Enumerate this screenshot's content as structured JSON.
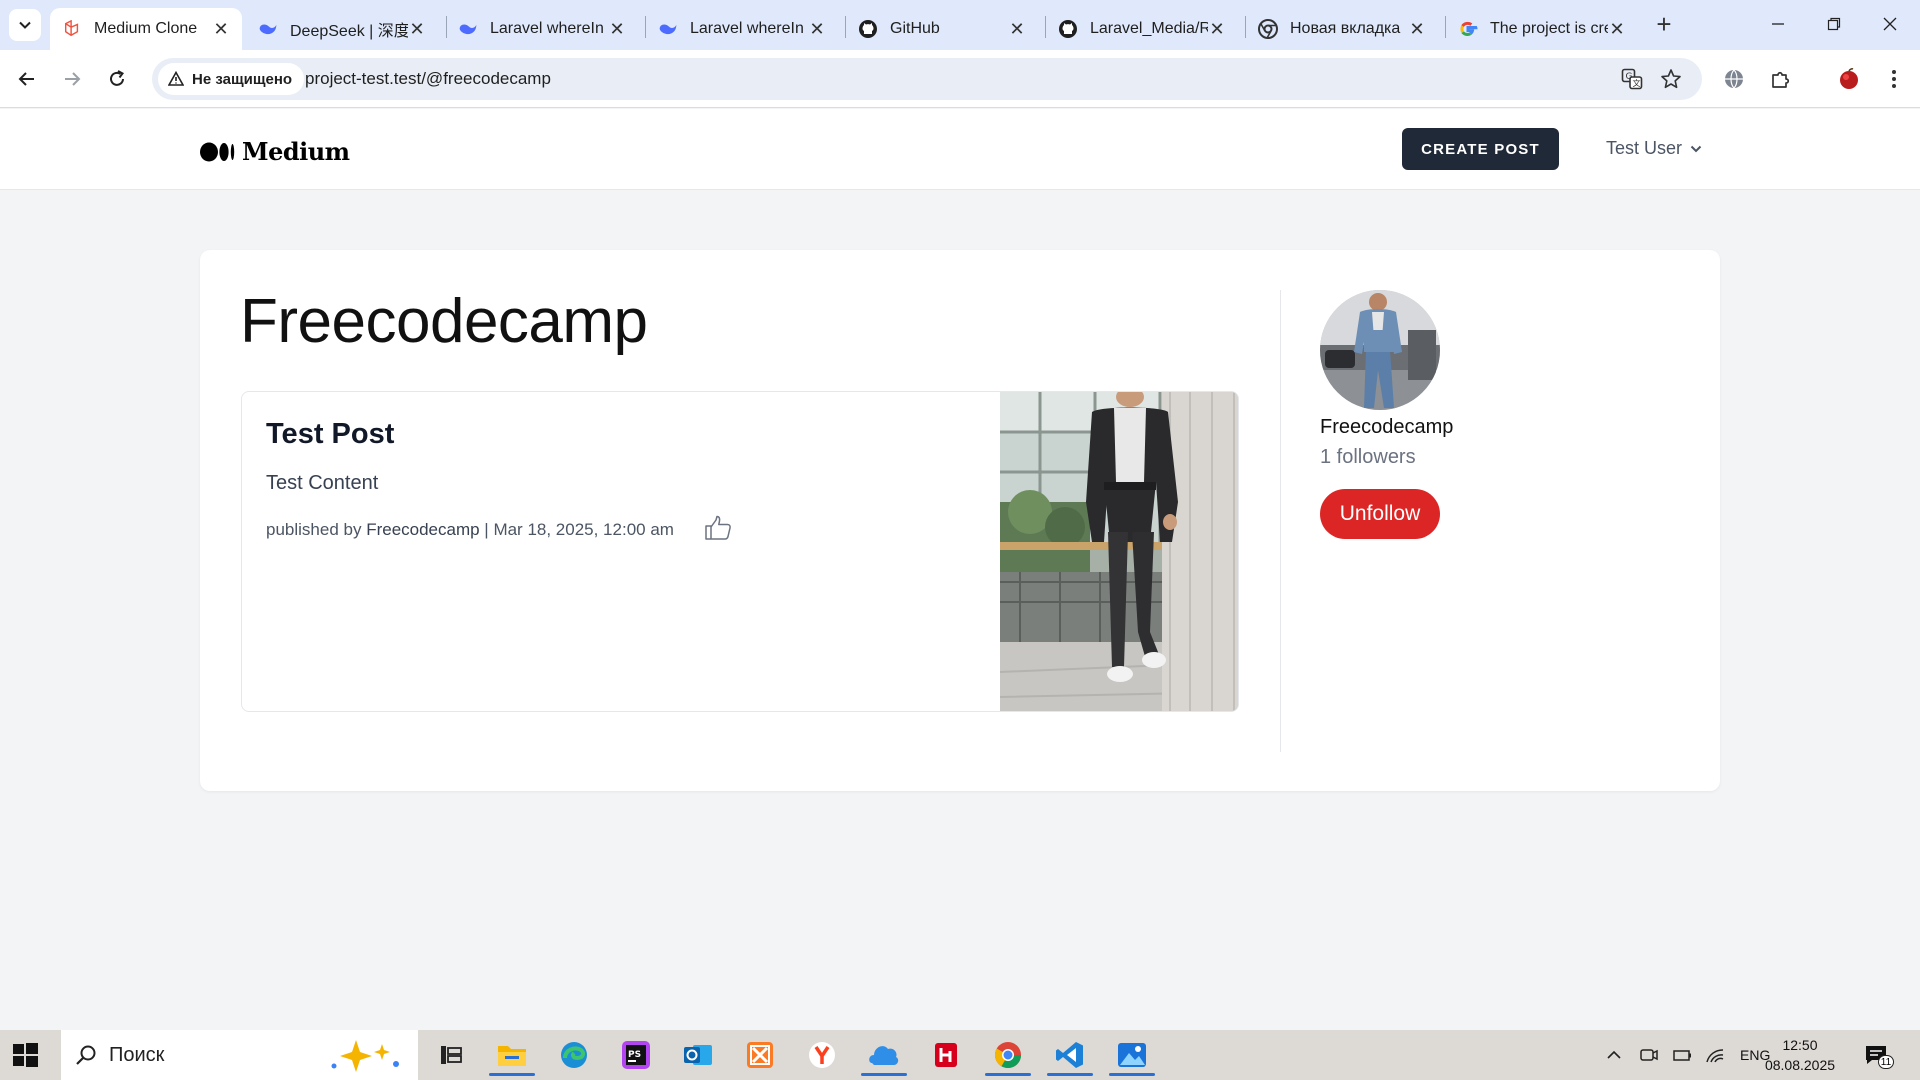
{
  "browser": {
    "tabs": [
      {
        "title": "Medium Clone",
        "icon": "laravel-icon",
        "active": true
      },
      {
        "title": "DeepSeek | 深度",
        "icon": "deepseek-icon"
      },
      {
        "title": "Laravel whereIn",
        "icon": "deepseek-icon"
      },
      {
        "title": "Laravel whereIn",
        "icon": "deepseek-icon"
      },
      {
        "title": "GitHub",
        "icon": "github-icon"
      },
      {
        "title": "Laravel_Media/R",
        "icon": "github-icon"
      },
      {
        "title": "Новая вкладка",
        "icon": "chrome-icon"
      },
      {
        "title": "The project is cre",
        "icon": "google-icon"
      }
    ],
    "security_label": "Не защищено",
    "url": "project-test.test/@freecodecamp"
  },
  "site": {
    "logo_text": "Medium",
    "create_post_label": "CREATE POST",
    "user_name": "Test User"
  },
  "profile": {
    "title": "Freecodecamp",
    "name": "Freecodecamp",
    "followers": "1 followers",
    "unfollow_label": "Unfollow"
  },
  "post": {
    "title": "Test Post",
    "content": "Test Content",
    "meta_prefix": "published by ",
    "author": "Freecodecamp",
    "meta_suffix": " | Mar 18, 2025, 12:00 am"
  },
  "taskbar": {
    "search_placeholder": "Поиск",
    "lang": "ENG",
    "time": "12:50",
    "date": "08.08.2025",
    "notification_count": "11"
  },
  "colors": {
    "accent_red": "#dc2626",
    "button_dark": "#1f2937",
    "tabstrip": "#dfe9fb"
  }
}
